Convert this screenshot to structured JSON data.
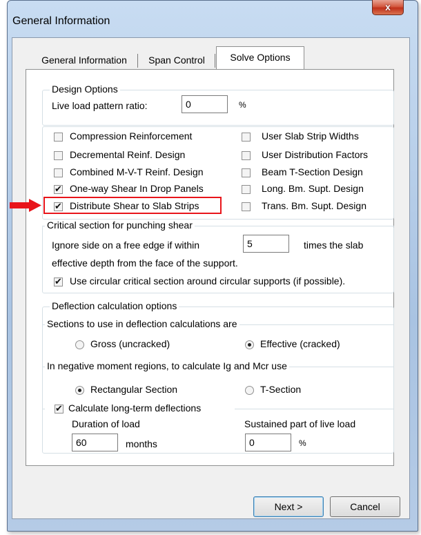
{
  "window": {
    "title": "General Information",
    "close_glyph": "x"
  },
  "tabs": [
    {
      "label": "General Information",
      "active": false
    },
    {
      "label": "Span Control",
      "active": false
    },
    {
      "label": "Solve Options",
      "active": true
    }
  ],
  "design_options": {
    "heading": "Design Options",
    "live_load_label": "Live load pattern ratio:",
    "live_load_value": "0",
    "live_load_unit": "%",
    "checkboxes_left": [
      {
        "label": "Compression Reinforcement",
        "checked": false
      },
      {
        "label": "Decremental Reinf. Design",
        "checked": false
      },
      {
        "label": "Combined M-V-T Reinf. Design",
        "checked": false
      },
      {
        "label": "One-way Shear In Drop Panels",
        "checked": true
      },
      {
        "label": "Distribute Shear to Slab Strips",
        "checked": true
      }
    ],
    "checkboxes_right": [
      {
        "label": "User Slab Strip Widths",
        "checked": false
      },
      {
        "label": "User Distribution Factors",
        "checked": false
      },
      {
        "label": "Beam T-Section Design",
        "checked": false
      },
      {
        "label": "Long. Bm. Supt. Design",
        "checked": false
      },
      {
        "label": "Trans. Bm. Supt. Design",
        "checked": false
      }
    ]
  },
  "punching": {
    "heading": "Critical section for punching shear",
    "ignore_label": "Ignore side on a free edge if within",
    "ignore_value": "5",
    "times_label": "times the slab",
    "effective_label": "effective depth from the face of the support.",
    "circular_label": "Use circular critical section around circular supports (if possible).",
    "circular_checked": true
  },
  "deflection": {
    "heading": "Deflection calculation options",
    "sections_heading": "Sections to use in deflection calculations are",
    "gross_label": "Gross (uncracked)",
    "effective_label": "Effective (cracked)",
    "selected_section": "effective",
    "negative_heading": "In negative moment regions, to calculate Ig and Mcr use",
    "rect_label": "Rectangular Section",
    "tsection_label": "T-Section",
    "selected_negative": "rectangular",
    "longterm_label": "Calculate long-term deflections",
    "longterm_checked": true,
    "duration_label": "Duration of load",
    "duration_value": "60",
    "duration_unit": "months",
    "sustained_label": "Sustained part of live load",
    "sustained_value": "0",
    "sustained_unit": "%"
  },
  "buttons": {
    "next": "Next >",
    "cancel": "Cancel"
  },
  "annotation": {
    "arrow_color": "#e8141a",
    "highlight_color": "#e8141a"
  }
}
